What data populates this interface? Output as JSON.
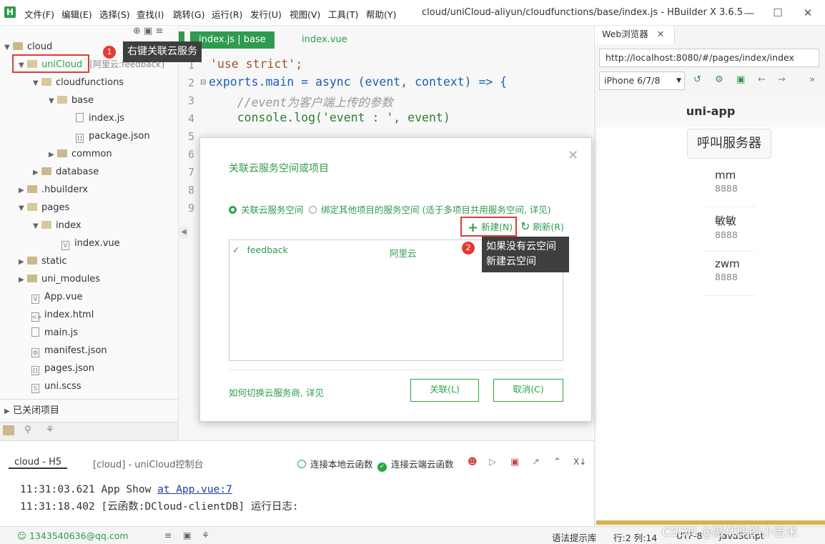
{
  "titlebar": {
    "logo": "H",
    "menus": [
      "文件(F)",
      "编辑(E)",
      "选择(S)",
      "查找(I)",
      "跳转(G)",
      "运行(R)",
      "发行(U)",
      "视图(V)",
      "工具(T)",
      "帮助(Y)"
    ],
    "title": "cloud/uniCloud-aliyun/cloudfunctions/base/index.js - HBuilder X 3.6.5"
  },
  "sidebar": {
    "root": "cloud",
    "unicloud": "uniCloud",
    "unicloud_tag": "[阿里云:feedback]",
    "cloudfunctions": "cloudfunctions",
    "base": "base",
    "index_js": "index.js",
    "package_json": "package.json",
    "common": "common",
    "database": "database",
    "hbuilderx": ".hbuilderx",
    "pages": "pages",
    "index": "index",
    "index_vue": "index.vue",
    "static": "static",
    "uni_modules": "uni_modules",
    "app_vue": "App.vue",
    "index_html": "index.html",
    "main_js": "main.js",
    "manifest": "manifest.json",
    "pages_json": "pages.json",
    "uni_scss": "uni.scss",
    "closed": "已关闭项目"
  },
  "editor": {
    "tab1": "index.js | base",
    "tab2": "index.vue",
    "lines": [
      "1",
      "2",
      "3",
      "4",
      "5",
      "6",
      "7",
      "8",
      "9"
    ],
    "code": [
      "'use strict';",
      "exports.main = async (event, context) => {",
      "    //event为客户端上传的参数",
      "    console.log('event : ', event)"
    ]
  },
  "dialog": {
    "title": "关联云服务空间或项目",
    "radio1": "关联云服务空间",
    "radio2": "绑定其他项目的服务空间 (适于多项目共用服务空间, 详见)",
    "new": "新建(N)",
    "refresh": "刷新(R)",
    "row_name": "feedback",
    "row_provider": "阿里云",
    "howto": "如何切换云服务商, 详见",
    "ok": "关联(L)",
    "cancel": "取消(C)"
  },
  "callouts": {
    "c1": "右键关联云服务",
    "c2": "如果没有云空间\n新建云空间",
    "n1": "1",
    "n2": "2"
  },
  "browser": {
    "tab": "Web浏览器",
    "url": "http://localhost:8080/#/pages/index/index",
    "device": "iPhone 6/7/8",
    "app_title": "uni-app",
    "call_btn": "呼叫服务器",
    "items": [
      {
        "name": "mm",
        "value": "8888"
      },
      {
        "name": "敏敏",
        "value": "8888"
      },
      {
        "name": "zwm",
        "value": "8888"
      }
    ]
  },
  "console": {
    "tab1": "cloud - H5",
    "tab2": "[cloud] - uniCloud控制台",
    "local": "连接本地云函数",
    "remote": "连接云端云函数",
    "log1_time": "11:31:03.621 App Show",
    "log1_link": "at App.vue:7",
    "log2": "11:31:18.402 [云函数:DCloud-clientDB] 运行日志:"
  },
  "status": {
    "user": "1343540636@qq.com",
    "hint": "语法提示库",
    "pos": "行:2  列:14",
    "enc": "UTF-8",
    "lang": "JavaScript",
    "watermark": "CSDN @敲代码的小吉米"
  },
  "colors": {
    "accent": "#28a745",
    "callout_red": "#e53935"
  }
}
